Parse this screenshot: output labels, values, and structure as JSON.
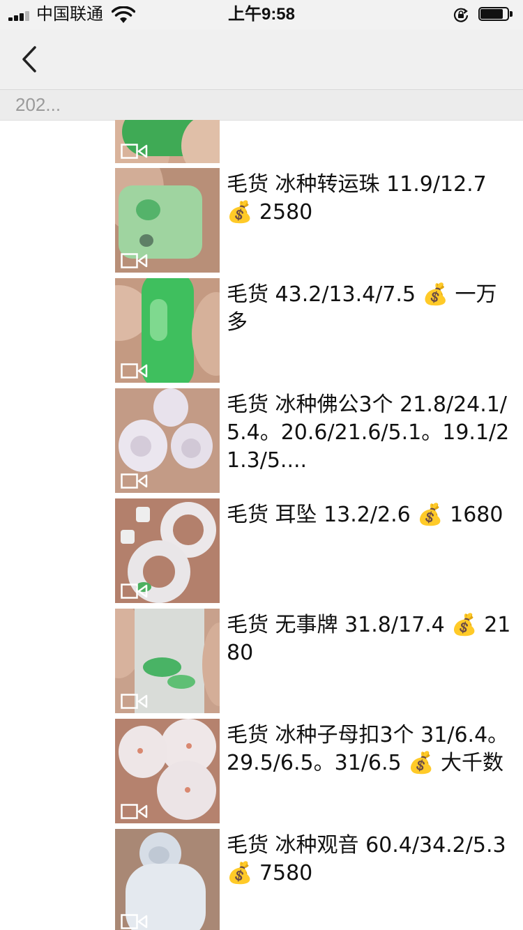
{
  "status_bar": {
    "carrier": "中国联通",
    "time": "上午9:58",
    "battery_percent": 85
  },
  "nav": {
    "back_icon": "chevron-left-icon"
  },
  "date_header": {
    "label": "202..."
  },
  "posts": [
    {
      "caption": "",
      "has_video": true
    },
    {
      "caption": "毛货 冰种转运珠 11.9/12.7 💰 2580",
      "has_video": true
    },
    {
      "caption": "毛货 43.2/13.4/7.5 💰 一万多",
      "has_video": true
    },
    {
      "caption": "毛货 冰种佛公3个 21.8/24.1/5.4。20.6/21.6/5.1。19.1/21.3/5....",
      "has_video": true
    },
    {
      "caption": "毛货 耳坠 13.2/2.6 💰 1680",
      "has_video": true
    },
    {
      "caption": "毛货 无事牌 31.8/17.4 💰 2180",
      "has_video": true
    },
    {
      "caption": "毛货 冰种子母扣3个 31/6.4。29.5/6.5。31/6.5 💰 大千数",
      "has_video": true
    },
    {
      "caption": "毛货 冰种观音 60.4/34.2/5.3 💰 7580",
      "has_video": true
    }
  ]
}
